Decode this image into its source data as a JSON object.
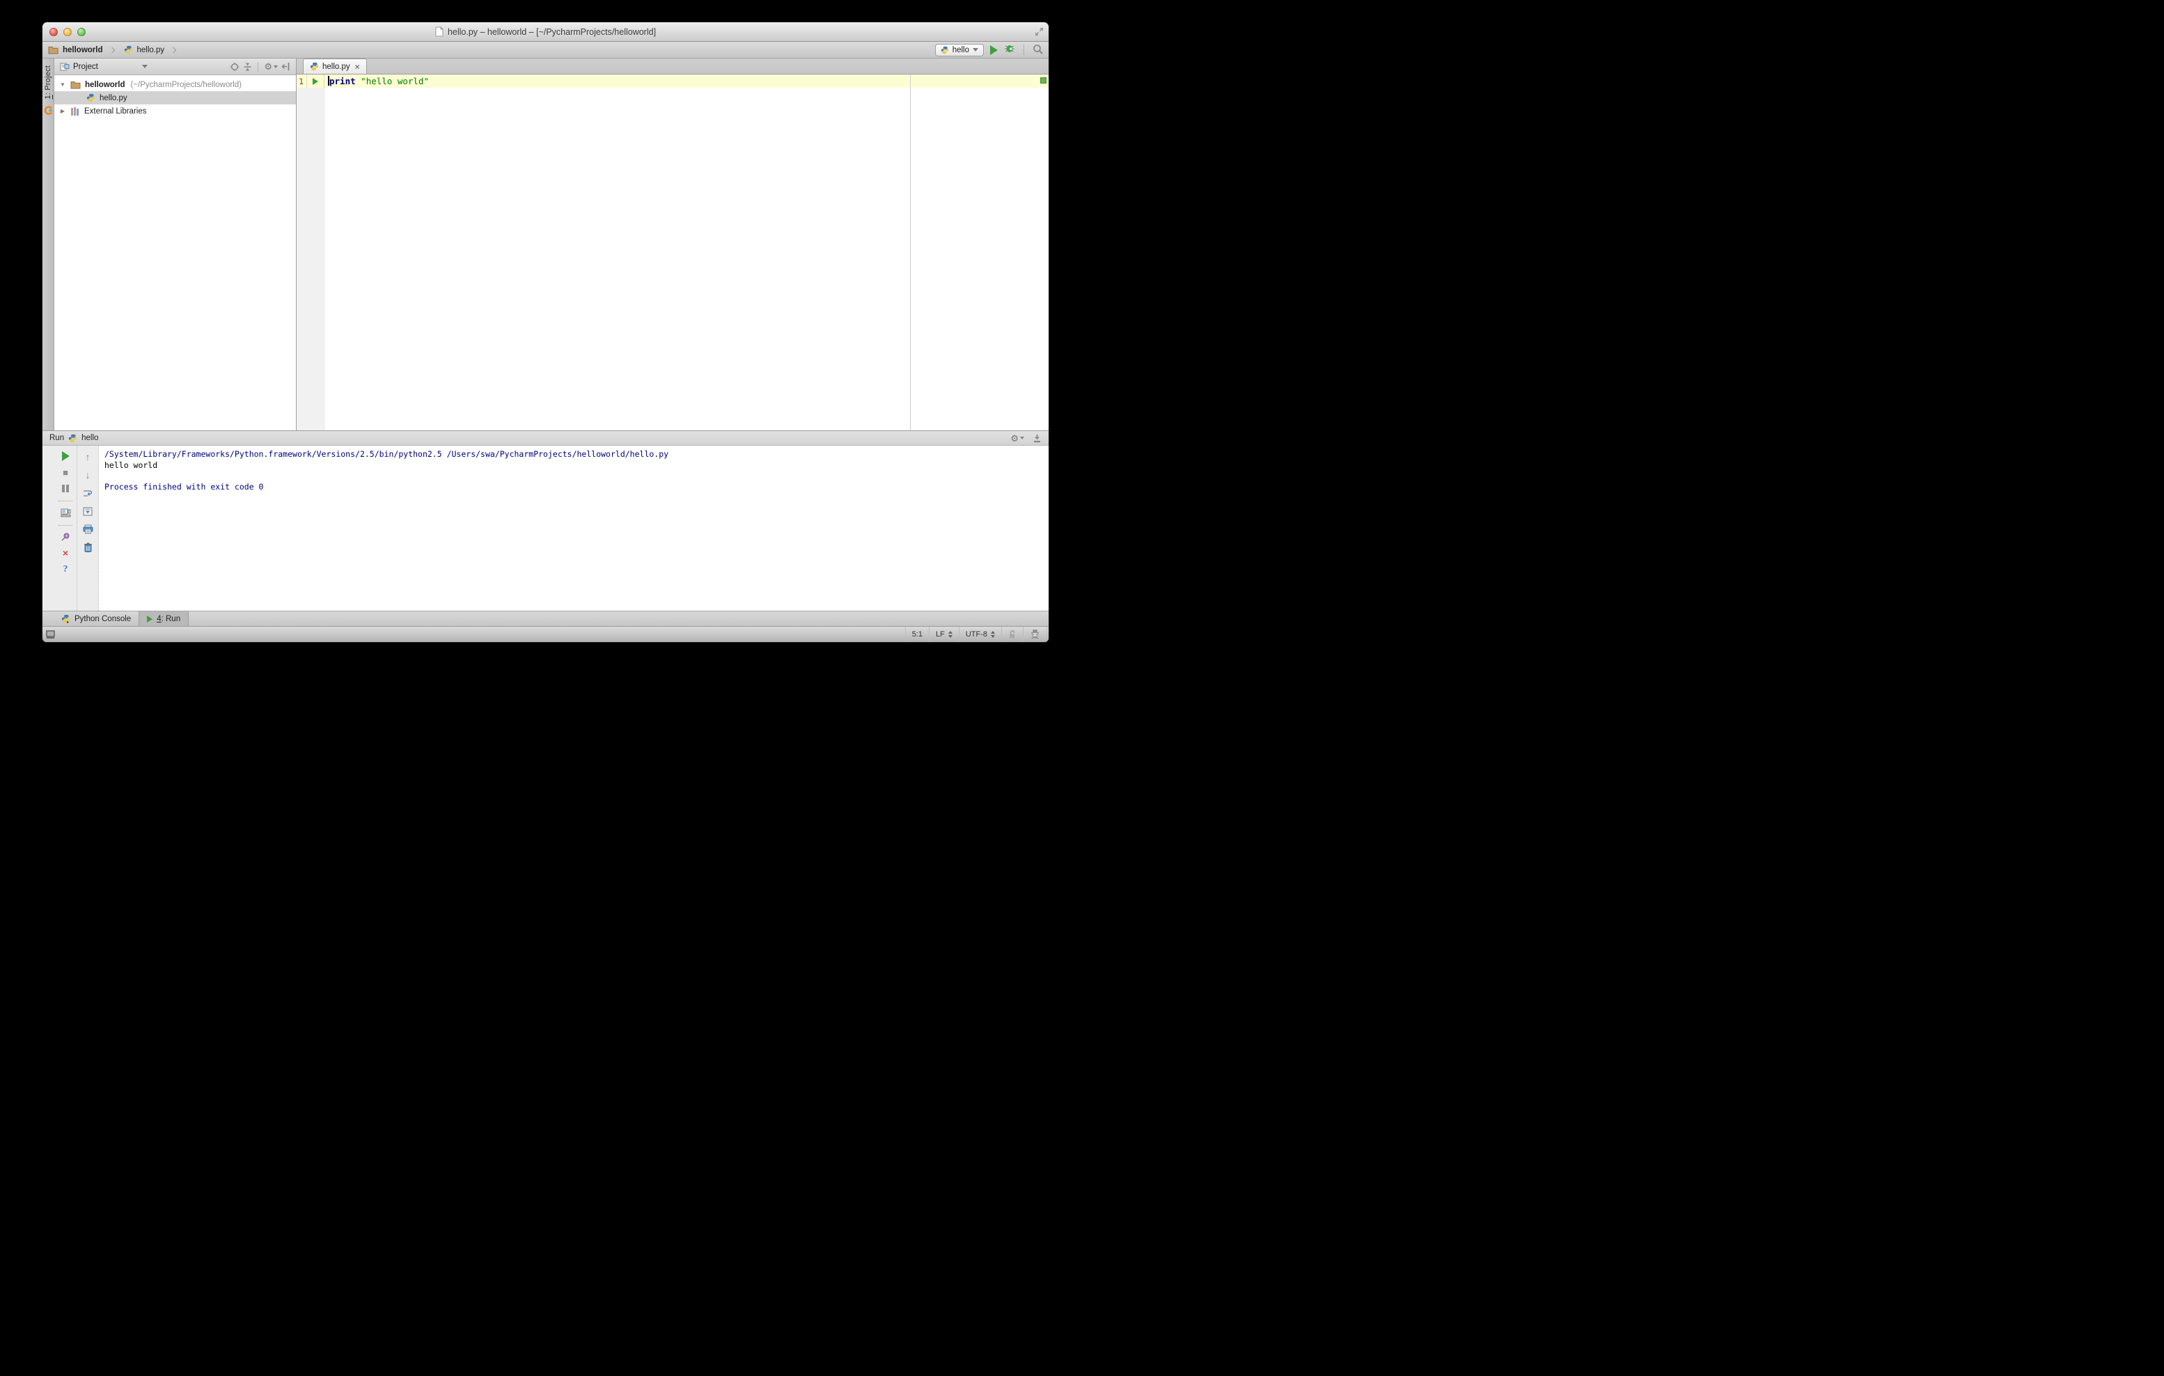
{
  "window": {
    "title": "hello.py – helloworld – [~/PycharmProjects/helloworld]"
  },
  "navbar": {
    "breadcrumbs": {
      "project": "helloworld",
      "file": "hello.py"
    },
    "run_config": {
      "name": "hello"
    }
  },
  "tool_stripe": {
    "project_num": "1",
    "project_rest": ": Project"
  },
  "project_panel": {
    "title": "Project",
    "tree": {
      "root_name": "helloworld",
      "root_path": "(~/PycharmProjects/helloworld)",
      "file": "hello.py",
      "external": "External Libraries"
    }
  },
  "editor": {
    "tab_label": "hello.py",
    "line_number": "1",
    "keyword": "print",
    "string": "\"hello world\""
  },
  "run_panel": {
    "title": "Run",
    "config_name": "hello",
    "console": [
      "/System/Library/Frameworks/Python.framework/Versions/2.5/bin/python2.5 /Users/swa/PycharmProjects/helloworld/hello.py",
      "hello world",
      "",
      "Process finished with exit code 0"
    ]
  },
  "bottom_bar": {
    "console_tab": "Python Console",
    "run_num": "4",
    "run_rest": ": Run"
  },
  "status_bar": {
    "caret_position": "5:1",
    "line_separator": "LF",
    "encoding": "UTF-8"
  },
  "icons": {
    "gear": "⚙",
    "close_tab": "×",
    "cross": "×",
    "stop": "■",
    "help": "?",
    "up": "↑",
    "down": "↓",
    "tree_expanded": "▼",
    "tree_collapsed": "▶"
  },
  "colors": {
    "keyword": "#000080",
    "string": "#008000",
    "console-info": "#000080",
    "line-highlight": "#fdfdd3",
    "line-number": "#8b3a3a",
    "run-green": "#3ca03c",
    "inspection-green": "#68b74e"
  }
}
